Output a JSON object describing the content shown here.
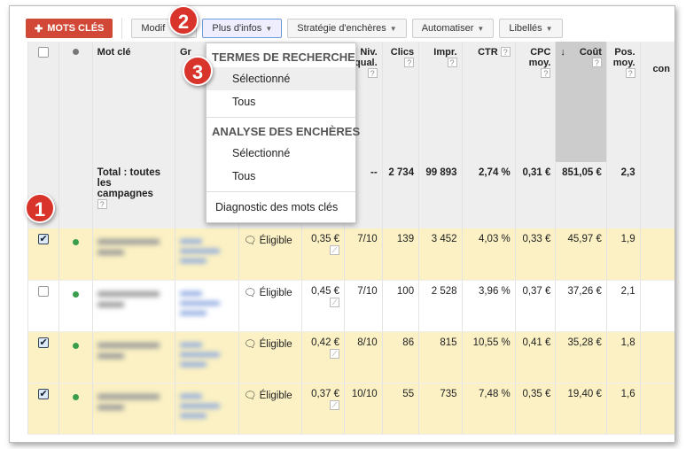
{
  "toolbar": {
    "add_keywords": "MOTS CLÉS",
    "modify": "Modif",
    "more_info": "Plus d'infos",
    "bid_strategy": "Stratégie d'enchères",
    "automate": "Automatiser",
    "labels": "Libellés"
  },
  "menu": {
    "search_terms_header": "TERMES DE RECHERCHE",
    "search_selected": "Sélectionné",
    "search_all": "Tous",
    "auction_header": "ANALYSE DES ENCHÈRES",
    "auction_selected": "Sélectionné",
    "auction_all": "Tous",
    "diagnostics": "Diagnostic des mots clés"
  },
  "badges": [
    "1",
    "2",
    "3"
  ],
  "columns": {
    "keyword": "Mot clé",
    "group": "Gr",
    "qual": "Niv. qual.",
    "clicks": "Clics",
    "impr": "Impr.",
    "ctr": "CTR",
    "cpc": "CPC moy.",
    "cost": "Coût",
    "pos": "Pos. moy.",
    "conv": "con",
    "help": "?",
    "sort_arrow": "↓"
  },
  "total": {
    "label": "Total : toutes les campagnes",
    "qual": "--",
    "clicks": "2 734",
    "impr": "99 893",
    "ctr": "2,74 %",
    "cpc": "0,31 €",
    "cost": "851,05 €",
    "pos": "2,3"
  },
  "rows": [
    {
      "checked": true,
      "status": "Éligible",
      "bid": "0,35 €",
      "qual": "7/10",
      "clicks": "139",
      "impr": "3 452",
      "ctr": "4,03 %",
      "cpc": "0,33 €",
      "cost": "45,97 €",
      "pos": "1,9"
    },
    {
      "checked": false,
      "status": "Éligible",
      "bid": "0,45 €",
      "qual": "7/10",
      "clicks": "100",
      "impr": "2 528",
      "ctr": "3,96 %",
      "cpc": "0,37 €",
      "cost": "37,26 €",
      "pos": "2,1"
    },
    {
      "checked": true,
      "status": "Éligible",
      "bid": "0,42 €",
      "qual": "8/10",
      "clicks": "86",
      "impr": "815",
      "ctr": "10,55 %",
      "cpc": "0,41 €",
      "cost": "35,28 €",
      "pos": "1,8"
    },
    {
      "checked": true,
      "status": "Éligible",
      "bid": "0,37 €",
      "qual": "10/10",
      "clicks": "55",
      "impr": "735",
      "ctr": "7,48 %",
      "cpc": "0,35 €",
      "cost": "19,40 €",
      "pos": "1,6"
    }
  ],
  "colors": {
    "selected_row": "#fbf1c4",
    "accent_red": "#d14836",
    "active_dot": "#3a9d4c"
  }
}
